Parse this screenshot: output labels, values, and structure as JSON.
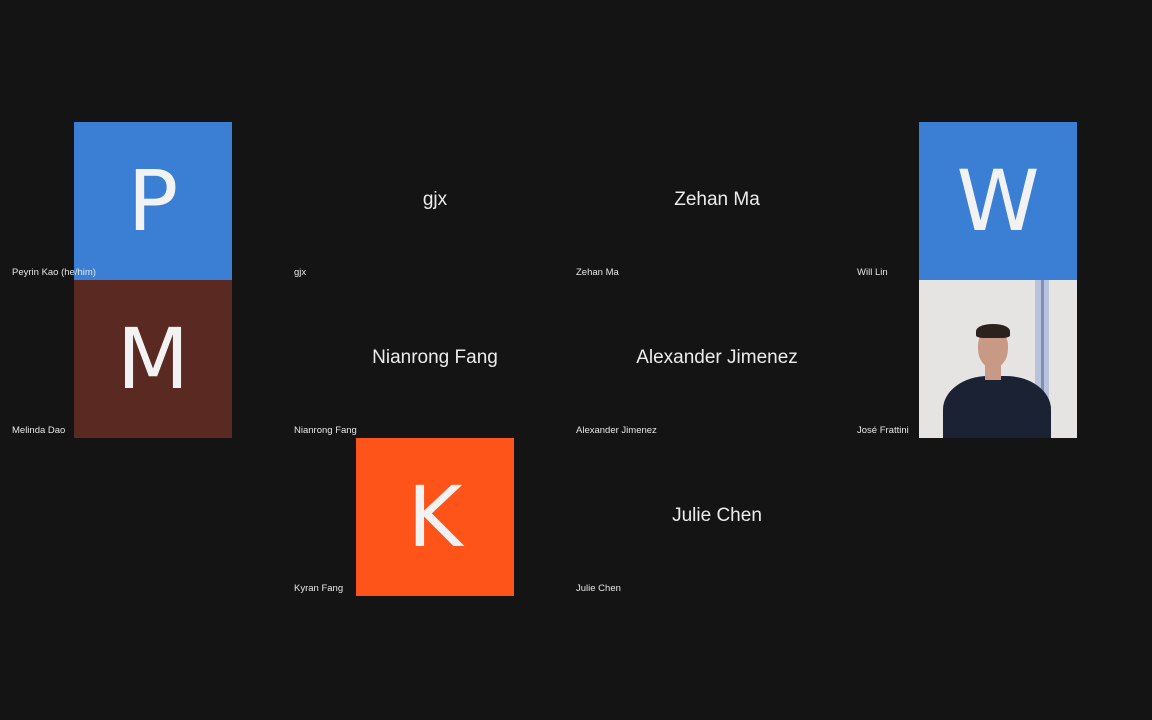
{
  "colors": {
    "background": "#141414",
    "avatar_blue": "#3b7fd4",
    "avatar_brown": "#5a2a22",
    "avatar_orange": "#ff5419"
  },
  "participants": [
    {
      "name": "Peyrin Kao (he/him)",
      "initial": "P"
    },
    {
      "name": "gjx",
      "display_name": "gjx"
    },
    {
      "name": "Zehan Ma",
      "display_name": "Zehan Ma"
    },
    {
      "name": "Will Lin",
      "initial": "W"
    },
    {
      "name": "Melinda Dao",
      "initial": "M"
    },
    {
      "name": "Nianrong Fang",
      "display_name": "Nianrong Fang"
    },
    {
      "name": "Alexander Jimenez",
      "display_name": "Alexander Jimenez"
    },
    {
      "name": "José Frattini"
    },
    {
      "name": "Kyran Fang",
      "initial": "K"
    },
    {
      "name": "Julie Chen",
      "display_name": "Julie Chen"
    }
  ]
}
